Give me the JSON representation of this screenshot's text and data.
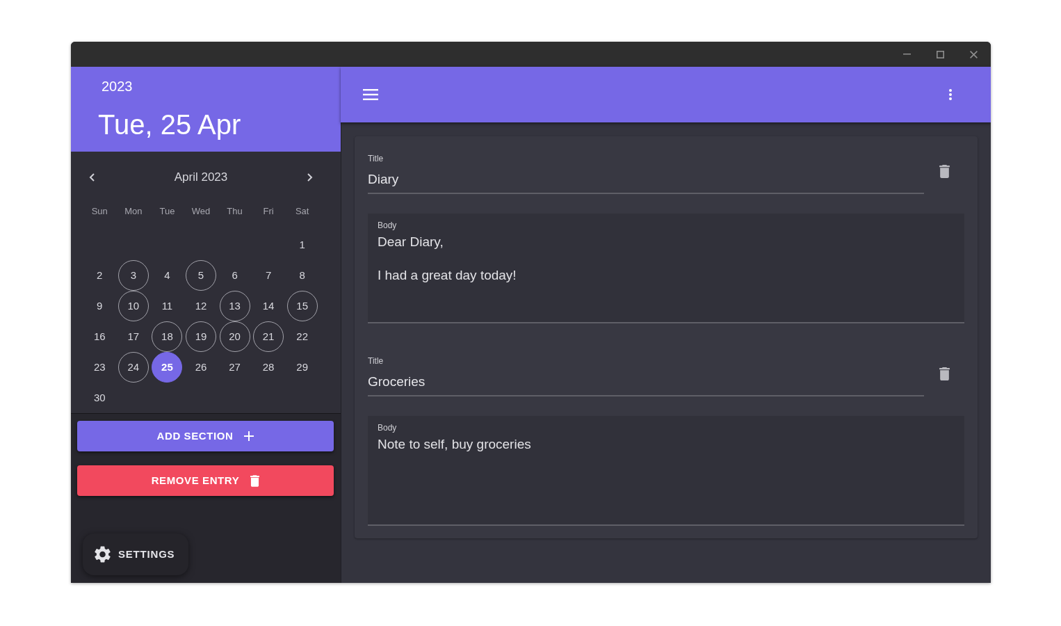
{
  "sidebar": {
    "year": "2023",
    "date": "Tue, 25 Apr"
  },
  "calendar": {
    "month": "April 2023",
    "weekdays": [
      "Sun",
      "Mon",
      "Tue",
      "Wed",
      "Thu",
      "Fri",
      "Sat"
    ],
    "weeks": [
      [
        {
          "kind": "blank"
        },
        {
          "kind": "blank"
        },
        {
          "kind": "blank"
        },
        {
          "kind": "blank"
        },
        {
          "kind": "blank"
        },
        {
          "kind": "blank"
        },
        {
          "kind": "day",
          "day": "1",
          "marked": false,
          "selected": false
        }
      ],
      [
        {
          "kind": "day",
          "day": "2",
          "marked": false,
          "selected": false
        },
        {
          "kind": "day",
          "day": "3",
          "marked": true,
          "selected": false
        },
        {
          "kind": "day",
          "day": "4",
          "marked": false,
          "selected": false
        },
        {
          "kind": "day",
          "day": "5",
          "marked": true,
          "selected": false
        },
        {
          "kind": "day",
          "day": "6",
          "marked": false,
          "selected": false
        },
        {
          "kind": "day",
          "day": "7",
          "marked": false,
          "selected": false
        },
        {
          "kind": "day",
          "day": "8",
          "marked": false,
          "selected": false
        }
      ],
      [
        {
          "kind": "day",
          "day": "9",
          "marked": false,
          "selected": false
        },
        {
          "kind": "day",
          "day": "10",
          "marked": true,
          "selected": false
        },
        {
          "kind": "day",
          "day": "11",
          "marked": false,
          "selected": false
        },
        {
          "kind": "day",
          "day": "12",
          "marked": false,
          "selected": false
        },
        {
          "kind": "day",
          "day": "13",
          "marked": true,
          "selected": false
        },
        {
          "kind": "day",
          "day": "14",
          "marked": false,
          "selected": false
        },
        {
          "kind": "day",
          "day": "15",
          "marked": true,
          "selected": false
        }
      ],
      [
        {
          "kind": "day",
          "day": "16",
          "marked": false,
          "selected": false
        },
        {
          "kind": "day",
          "day": "17",
          "marked": false,
          "selected": false
        },
        {
          "kind": "day",
          "day": "18",
          "marked": true,
          "selected": false
        },
        {
          "kind": "day",
          "day": "19",
          "marked": true,
          "selected": false
        },
        {
          "kind": "day",
          "day": "20",
          "marked": true,
          "selected": false
        },
        {
          "kind": "day",
          "day": "21",
          "marked": true,
          "selected": false
        },
        {
          "kind": "day",
          "day": "22",
          "marked": false,
          "selected": false
        }
      ],
      [
        {
          "kind": "day",
          "day": "23",
          "marked": false,
          "selected": false
        },
        {
          "kind": "day",
          "day": "24",
          "marked": true,
          "selected": false
        },
        {
          "kind": "day",
          "day": "25",
          "marked": false,
          "selected": true
        },
        {
          "kind": "day",
          "day": "26",
          "marked": false,
          "selected": false
        },
        {
          "kind": "day",
          "day": "27",
          "marked": false,
          "selected": false
        },
        {
          "kind": "day",
          "day": "28",
          "marked": false,
          "selected": false
        },
        {
          "kind": "day",
          "day": "29",
          "marked": false,
          "selected": false
        }
      ],
      [
        {
          "kind": "day",
          "day": "30",
          "marked": false,
          "selected": false
        }
      ]
    ]
  },
  "actions": [
    {
      "kind": "add",
      "label": "ADD SECTION"
    },
    {
      "kind": "remove",
      "label": "REMOVE ENTRY"
    }
  ],
  "settings": {
    "label": "SETTINGS"
  },
  "sections": [
    {
      "title_label": "Title",
      "title": "Diary",
      "body_label": "Body",
      "body": "Dear Diary,\n\nI had a great day today!"
    },
    {
      "title_label": "Title",
      "title": "Groceries",
      "body_label": "Body",
      "body": "Note to self, buy groceries"
    }
  ]
}
